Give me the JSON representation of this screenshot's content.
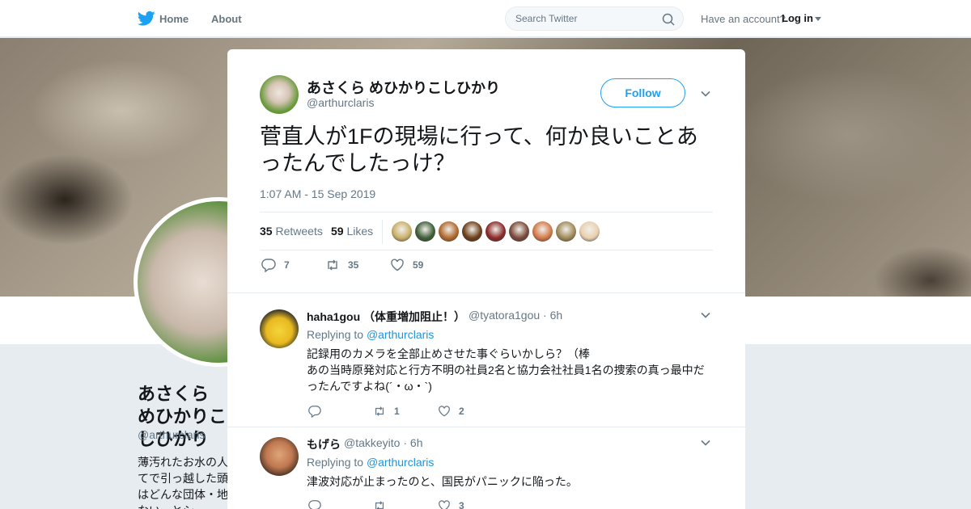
{
  "nav": {
    "home_label": "Home",
    "about_label": "About",
    "search_placeholder": "Search Twitter",
    "have_account": "Have an account?",
    "login_label": "Log in",
    "brand_color": "#1da1f2"
  },
  "background_profile": {
    "name": "あさくら めひかりこしひかり",
    "handle": "@arthurclaris",
    "bio": "薄汚れたお水の人\nてで引っ越した頭\nはどんな団体・地\nない、とシ..."
  },
  "tweet": {
    "author_name": "あさくら めひかりこしひかり",
    "author_handle": "@arthurclaris",
    "follow_label": "Follow",
    "text": "菅直人が1Fの現場に行って、何か良いことあったんでしたっけ？",
    "timestamp": "1:07 AM - 15 Sep 2019",
    "retweets_count": "35",
    "retweets_label": "Retweets",
    "likes_count": "59",
    "likes_label": "Likes",
    "replies_action": "7",
    "retweets_action": "35",
    "likes_action": "59",
    "liker_avatars": [
      "#c9b16a",
      "#3f5f3a",
      "#b06a2e",
      "#6b3f1c",
      "#8c2a2a",
      "#7a4a3a",
      "#d27a4a",
      "#a08a5a",
      "#e8d0b0"
    ]
  },
  "replies": [
    {
      "name": "haha1gou （体重増加阻止！）",
      "handle": "@tyatora1gou",
      "time": "· 6h",
      "replying_label": "Replying to",
      "replying_to": "@arthurclaris",
      "text": "記録用のカメラを全部止めさせた事ぐらいかしら？（棒\nあの当時原発対応と行方不明の社員2名と協力会社社員1名の捜索の真っ最中だったんですよね(´・ω・`)",
      "reply_count": "",
      "retweet_count": "1",
      "like_count": "2"
    },
    {
      "name": "もげら",
      "handle": "@takkeyito",
      "time": "· 6h",
      "replying_label": "Replying to",
      "replying_to": "@arthurclaris",
      "text": "津波対応が止まったのと、国民がパニックに陥った。",
      "reply_count": "",
      "retweet_count": "",
      "like_count": "3"
    }
  ]
}
